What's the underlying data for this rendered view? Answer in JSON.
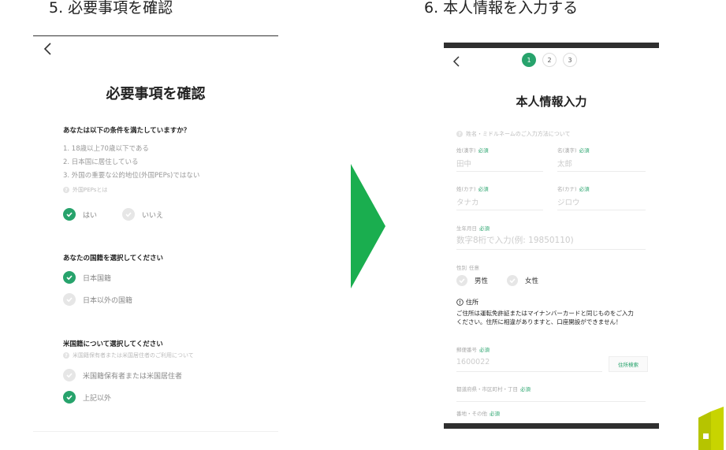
{
  "left": {
    "heading": "5. 必要事項を確認",
    "back_icon": "chevron-left-icon",
    "title": "必要事項を確認",
    "q1": {
      "label": "あなたは以下の条件を満たしていますか？",
      "conditions": [
        "1. 18歳以上70歳以下である",
        "2. 日本国に居住している",
        "3. 外国の重要な公的地位(外国PEPs)ではない"
      ],
      "help": "外国PEPsとは",
      "yes": "はい",
      "no": "いいえ"
    },
    "q2": {
      "label": "あなたの国籍を選択してください",
      "options": [
        "日本国籍",
        "日本以外の国籍"
      ]
    },
    "q3": {
      "label": "米国籍について選択してください",
      "help": "米国籍保有者または米国居住者のご利用について",
      "options": [
        "米国籍保有者または米国居住者",
        "上記以外"
      ]
    }
  },
  "right": {
    "heading": "6. 本人情報を入力する",
    "back_icon": "chevron-left-icon",
    "steps": [
      "1",
      "2",
      "3"
    ],
    "title": "本人情報入力",
    "help": "姓名・ミドルネームのご入力方法について",
    "required": "必須",
    "optional": "任意",
    "last_kanji": {
      "label": "姓(漢字)",
      "placeholder": "田中"
    },
    "first_kanji": {
      "label": "名(漢字)",
      "placeholder": "太郎"
    },
    "last_kana": {
      "label": "姓(カナ)",
      "placeholder": "タナカ"
    },
    "first_kana": {
      "label": "名(カナ)",
      "placeholder": "ジロウ"
    },
    "birth": {
      "label": "生年月日",
      "placeholder": "数字8桁で入力(例: 19850110)"
    },
    "gender": {
      "label": "性別",
      "male": "男性",
      "female": "女性"
    },
    "address_note": {
      "title": "住所",
      "lines": [
        "ご住所は運転免許証またはマイナンバーカードと同じものをご入力",
        "ください。住所に相違がありますと、口座開設ができません！"
      ]
    },
    "postal": {
      "label": "郵便番号",
      "placeholder": "1600022",
      "button": "住所検索"
    },
    "pref": {
      "label": "都道府県・市区町村・丁目"
    },
    "street": {
      "label": "番地・その他"
    }
  },
  "colors": {
    "accent": "#27a36c",
    "arrow": "#1aae4f",
    "logo_yellow": "#c8d400"
  }
}
